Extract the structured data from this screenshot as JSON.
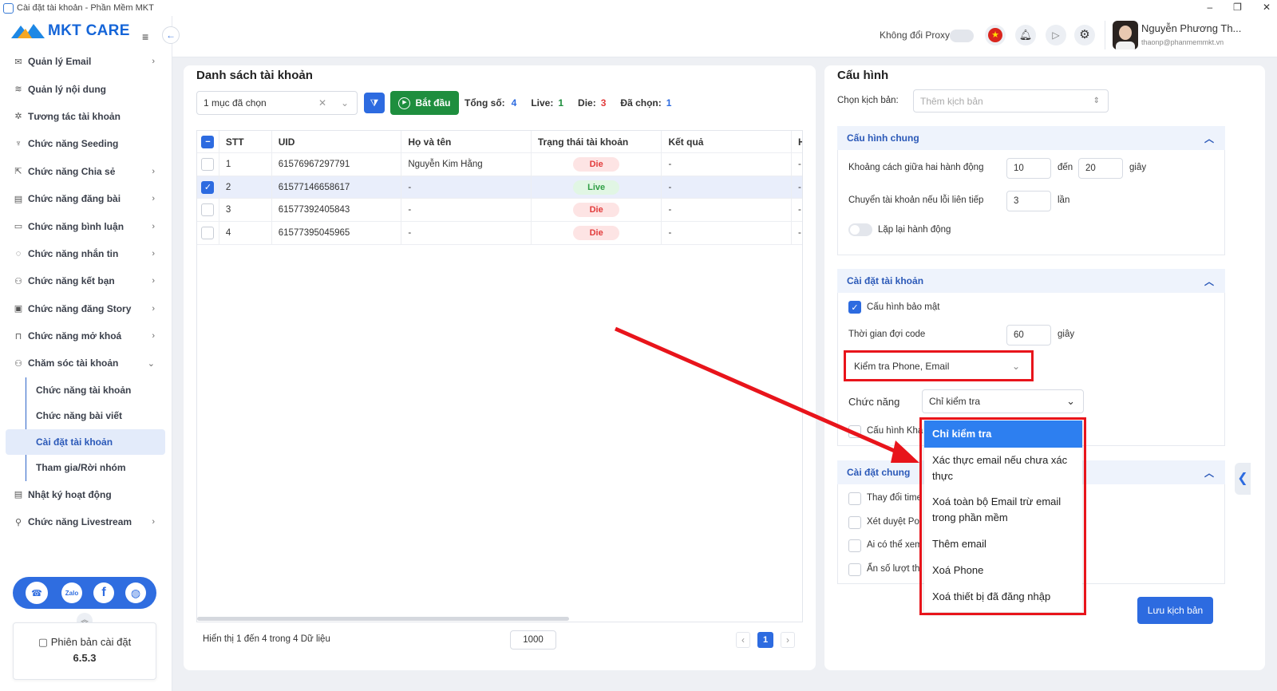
{
  "window": {
    "title": "Cài đặt tài khoản - Phần Mềm MKT",
    "min": "–",
    "max": "❐",
    "close": "✕"
  },
  "logo": {
    "text": "MKT CARE"
  },
  "header": {
    "proxy_label": "Không đổi Proxy",
    "user_name": "Nguyễn Phương Th...",
    "user_email": "thaonp@phanmemmkt.vn"
  },
  "sidebar": {
    "items": [
      {
        "label": "Quản lý Email",
        "icon": "✉",
        "chevron": "›"
      },
      {
        "label": "Quản lý nội dung",
        "icon": "≋",
        "chevron": ""
      },
      {
        "label": "Tương tác tài khoản",
        "icon": "✲",
        "chevron": ""
      },
      {
        "label": "Chức năng Seeding",
        "icon": "♆",
        "chevron": ""
      },
      {
        "label": "Chức năng Chia sẻ",
        "icon": "⇱",
        "chevron": "›"
      },
      {
        "label": "Chức năng đăng bài",
        "icon": "▤",
        "chevron": "›"
      },
      {
        "label": "Chức năng bình luận",
        "icon": "▭",
        "chevron": "›"
      },
      {
        "label": "Chức năng nhắn tin",
        "icon": "◌",
        "chevron": "›"
      },
      {
        "label": "Chức năng kết bạn",
        "icon": "⚇",
        "chevron": "›"
      },
      {
        "label": "Chức năng đăng Story",
        "icon": "▣",
        "chevron": "›"
      },
      {
        "label": "Chức năng mở khoá",
        "icon": "⊓",
        "chevron": "›"
      },
      {
        "label": "Chăm sóc tài khoản",
        "icon": "⚇",
        "chevron": "⌄"
      }
    ],
    "subitems": [
      "Chức năng tài khoản",
      "Chức năng bài viết",
      "Cài đặt tài khoản",
      "Tham gia/Rời nhóm"
    ],
    "items2": [
      {
        "label": "Nhật ký hoạt động",
        "icon": "▤",
        "chevron": ""
      },
      {
        "label": "Chức năng Livestream",
        "icon": "⚲",
        "chevron": "›"
      }
    ],
    "social": [
      "Zalo",
      "f"
    ],
    "version_label": "Phiên bản cài đặt",
    "version": "6.5.3"
  },
  "list": {
    "title": "Danh sách tài khoản",
    "select_value": "1 mục đã chọn",
    "start_label": "Bắt đầu",
    "total_label": "Tổng số:",
    "total": "4",
    "live_label": "Live:",
    "live": "1",
    "die_label": "Die:",
    "die": "3",
    "chosen_label": "Đã chọn:",
    "chosen": "1",
    "columns": [
      "STT",
      "UID",
      "Họ và tên",
      "Trạng thái tài khoản",
      "Kết quả",
      "H"
    ],
    "rows": [
      {
        "stt": "1",
        "uid": "61576967297791",
        "name": "Nguyễn Kim Hằng",
        "status": "Die",
        "result": "-",
        "last": "-",
        "checked": false
      },
      {
        "stt": "2",
        "uid": "61577146658617",
        "name": "-",
        "status": "Live",
        "result": "-",
        "last": "-",
        "checked": true
      },
      {
        "stt": "3",
        "uid": "61577392405843",
        "name": "-",
        "status": "Die",
        "result": "-",
        "last": "-",
        "checked": false
      },
      {
        "stt": "4",
        "uid": "61577395045965",
        "name": "-",
        "status": "Die",
        "result": "-",
        "last": "-",
        "checked": false
      }
    ],
    "footer": "Hiển thị 1 đến 4 trong 4 Dữ liệu",
    "page_size": "1000",
    "page": "1"
  },
  "config": {
    "title": "Cấu hình",
    "scenario_label": "Chọn kịch bản:",
    "scenario_placeholder": "Thêm kịch bản",
    "general": {
      "title": "Cấu hình chung",
      "delay_label": "Khoảng cách giữa hai hành động",
      "delay_from": "10",
      "to_label": "đến",
      "delay_to": "20",
      "unit_sec": "giây",
      "switch_label": "Chuyển tài khoản nếu lỗi liên tiếp",
      "switch_value": "3",
      "times": "lần",
      "repeat_label": "Lặp lại hành động"
    },
    "account": {
      "title": "Cài đặt tài khoản",
      "security_label": "Cấu hình bảo mật",
      "wait_label": "Thời gian đợi code",
      "wait_value": "60",
      "unit_sec": "giây",
      "check_select": "Kiểm tra Phone, Email",
      "func_label": "Chức năng",
      "func_value": "Chỉ kiểm tra",
      "other_label": "Cấu hình Khá"
    },
    "common": {
      "title": "Cài đặt chung",
      "options": [
        "Thay đổi time",
        "Xét duyệt Po",
        "Ai có thể xem",
        "Ẩn số lượt th"
      ]
    },
    "dropdown": [
      "Chỉ kiểm tra",
      "Xác thực email nếu chưa xác thực",
      "Xoá toàn bộ Email trừ email trong phần mềm",
      "Thêm email",
      "Xoá Phone",
      "Xoá thiết bị đã đăng nhập"
    ],
    "save_label": "Lưu kịch bản"
  },
  "colors": {
    "primary": "#2d6be0",
    "green": "#1e8e3e",
    "red": "#e8141b"
  }
}
